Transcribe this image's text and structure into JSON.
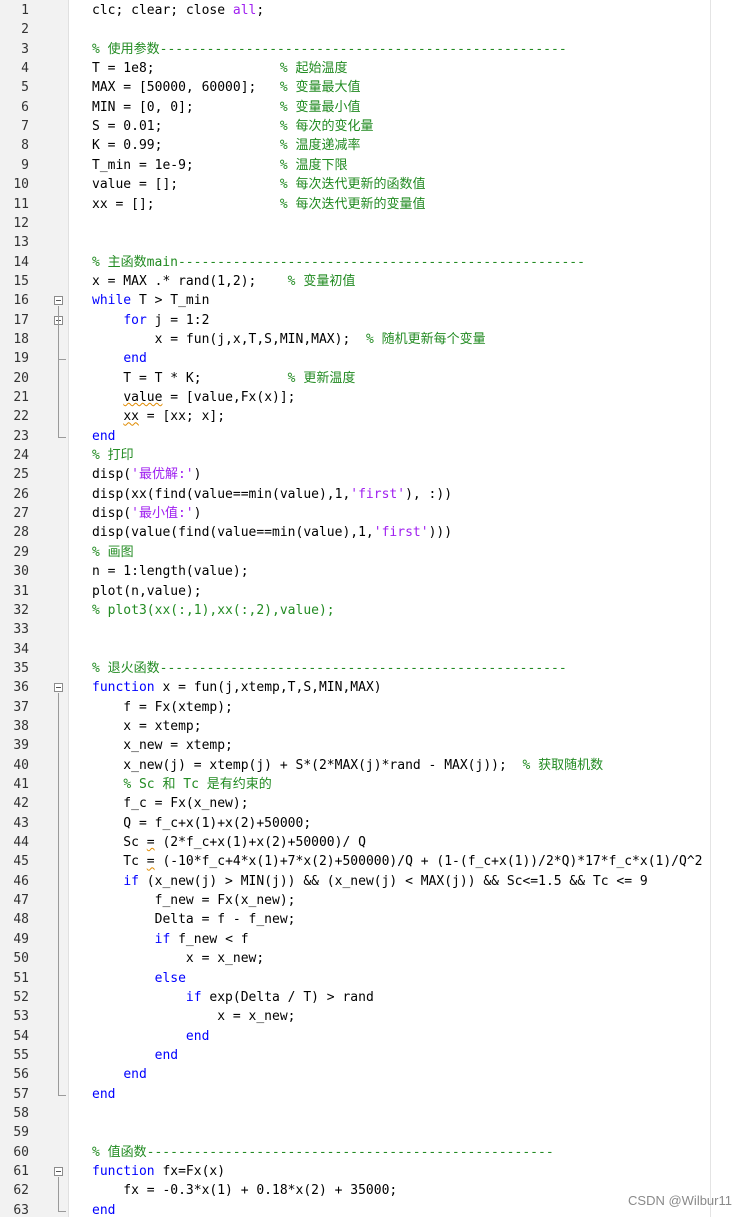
{
  "editor": {
    "lines": [
      {
        "n": "1",
        "t": "clc; clear; close all;",
        "spans": [
          {
            "s": "clc; clear; close ",
            "c": ""
          },
          {
            "s": "all",
            "c": "str"
          },
          {
            "s": ";",
            "c": ""
          }
        ]
      },
      {
        "n": "2",
        "spans": []
      },
      {
        "n": "3",
        "spans": [
          {
            "s": "% 使用参数----------------------------------------------------",
            "c": "cm"
          }
        ]
      },
      {
        "n": "4",
        "spans": [
          {
            "s": "T = 1e8;                ",
            "c": ""
          },
          {
            "s": "% 起始温度",
            "c": "cm"
          }
        ]
      },
      {
        "n": "5",
        "spans": [
          {
            "s": "MAX = [50000, 60000];   ",
            "c": ""
          },
          {
            "s": "% 变量最大值",
            "c": "cm"
          }
        ]
      },
      {
        "n": "6",
        "spans": [
          {
            "s": "MIN = [0, 0];           ",
            "c": ""
          },
          {
            "s": "% 变量最小值",
            "c": "cm"
          }
        ]
      },
      {
        "n": "7",
        "spans": [
          {
            "s": "S = 0.01;               ",
            "c": ""
          },
          {
            "s": "% 每次的变化量",
            "c": "cm"
          }
        ]
      },
      {
        "n": "8",
        "spans": [
          {
            "s": "K = 0.99;               ",
            "c": ""
          },
          {
            "s": "% 温度递减率",
            "c": "cm"
          }
        ]
      },
      {
        "n": "9",
        "spans": [
          {
            "s": "T_min = 1e-9;           ",
            "c": ""
          },
          {
            "s": "% 温度下限",
            "c": "cm"
          }
        ]
      },
      {
        "n": "10",
        "spans": [
          {
            "s": "value = [];             ",
            "c": ""
          },
          {
            "s": "% 每次迭代更新的函数值",
            "c": "cm"
          }
        ]
      },
      {
        "n": "11",
        "spans": [
          {
            "s": "xx = [];                ",
            "c": ""
          },
          {
            "s": "% 每次迭代更新的变量值",
            "c": "cm"
          }
        ]
      },
      {
        "n": "12",
        "spans": []
      },
      {
        "n": "13",
        "spans": []
      },
      {
        "n": "14",
        "spans": [
          {
            "s": "% 主函数main----------------------------------------------------",
            "c": "cm"
          }
        ]
      },
      {
        "n": "15",
        "spans": [
          {
            "s": "x = MAX .* rand(1,2);    ",
            "c": ""
          },
          {
            "s": "% 变量初值",
            "c": "cm"
          }
        ]
      },
      {
        "n": "16",
        "spans": [
          {
            "s": "while",
            "c": "kw"
          },
          {
            "s": " T > T_min",
            "c": ""
          }
        ]
      },
      {
        "n": "17",
        "spans": [
          {
            "s": "    ",
            "c": ""
          },
          {
            "s": "for",
            "c": "kw"
          },
          {
            "s": " j = 1:2",
            "c": ""
          }
        ]
      },
      {
        "n": "18",
        "spans": [
          {
            "s": "        x = fun(j,x,T,S,MIN,MAX);  ",
            "c": ""
          },
          {
            "s": "% 随机更新每个变量",
            "c": "cm"
          }
        ]
      },
      {
        "n": "19",
        "spans": [
          {
            "s": "    ",
            "c": ""
          },
          {
            "s": "end",
            "c": "kw"
          }
        ]
      },
      {
        "n": "20",
        "spans": [
          {
            "s": "    T = T * K;           ",
            "c": ""
          },
          {
            "s": "% 更新温度",
            "c": "cm"
          }
        ]
      },
      {
        "n": "21",
        "spans": [
          {
            "s": "    ",
            "c": ""
          },
          {
            "s": "value",
            "c": "sq"
          },
          {
            "s": " = [value,Fx(x)];",
            "c": ""
          }
        ]
      },
      {
        "n": "22",
        "spans": [
          {
            "s": "    ",
            "c": ""
          },
          {
            "s": "xx",
            "c": "sq"
          },
          {
            "s": " = [xx; x];",
            "c": ""
          }
        ]
      },
      {
        "n": "23",
        "spans": [
          {
            "s": "end",
            "c": "kw"
          }
        ]
      },
      {
        "n": "24",
        "spans": [
          {
            "s": "% 打印",
            "c": "cm"
          }
        ]
      },
      {
        "n": "25",
        "spans": [
          {
            "s": "disp(",
            "c": ""
          },
          {
            "s": "'最优解:'",
            "c": "str"
          },
          {
            "s": ")",
            "c": ""
          }
        ]
      },
      {
        "n": "26",
        "spans": [
          {
            "s": "disp(xx(find(value==min(value),1,",
            "c": ""
          },
          {
            "s": "'first'",
            "c": "str"
          },
          {
            "s": "), :))",
            "c": ""
          }
        ]
      },
      {
        "n": "27",
        "spans": [
          {
            "s": "disp(",
            "c": ""
          },
          {
            "s": "'最小值:'",
            "c": "str"
          },
          {
            "s": ")",
            "c": ""
          }
        ]
      },
      {
        "n": "28",
        "spans": [
          {
            "s": "disp(value(find(value==min(value),1,",
            "c": ""
          },
          {
            "s": "'first'",
            "c": "str"
          },
          {
            "s": ")))",
            "c": ""
          }
        ]
      },
      {
        "n": "29",
        "spans": [
          {
            "s": "% 画图",
            "c": "cm"
          }
        ]
      },
      {
        "n": "30",
        "spans": [
          {
            "s": "n = 1:length(value);",
            "c": ""
          }
        ]
      },
      {
        "n": "31",
        "spans": [
          {
            "s": "plot(n,value);",
            "c": ""
          }
        ]
      },
      {
        "n": "32",
        "spans": [
          {
            "s": "% plot3(xx(:,1),xx(:,2),value);",
            "c": "cm"
          }
        ]
      },
      {
        "n": "33",
        "spans": []
      },
      {
        "n": "34",
        "spans": []
      },
      {
        "n": "35",
        "spans": [
          {
            "s": "% 退火函数----------------------------------------------------",
            "c": "cm"
          }
        ]
      },
      {
        "n": "36",
        "spans": [
          {
            "s": "function",
            "c": "kw"
          },
          {
            "s": " x = fun(j,xtemp,T,S,MIN,MAX)",
            "c": ""
          }
        ]
      },
      {
        "n": "37",
        "spans": [
          {
            "s": "    f = Fx(xtemp);",
            "c": ""
          }
        ]
      },
      {
        "n": "38",
        "spans": [
          {
            "s": "    x = xtemp;",
            "c": ""
          }
        ]
      },
      {
        "n": "39",
        "spans": [
          {
            "s": "    x_new = xtemp;",
            "c": ""
          }
        ]
      },
      {
        "n": "40",
        "spans": [
          {
            "s": "    x_new(j) = xtemp(j) + S*(2*MAX(j)*rand - MAX(j));  ",
            "c": ""
          },
          {
            "s": "% 获取随机数",
            "c": "cm"
          }
        ]
      },
      {
        "n": "41",
        "spans": [
          {
            "s": "    ",
            "c": ""
          },
          {
            "s": "% Sc 和 Tc 是有约束的",
            "c": "cm"
          }
        ]
      },
      {
        "n": "42",
        "spans": [
          {
            "s": "    f_c = Fx(x_new);",
            "c": ""
          }
        ]
      },
      {
        "n": "43",
        "spans": [
          {
            "s": "    Q = f_c+x(1)+x(2)+50000;",
            "c": ""
          }
        ]
      },
      {
        "n": "44",
        "spans": [
          {
            "s": "    Sc ",
            "c": ""
          },
          {
            "s": "=",
            "c": "sq"
          },
          {
            "s": " (2*f_c+x(1)+x(2)+50000)/ Q",
            "c": ""
          }
        ]
      },
      {
        "n": "45",
        "spans": [
          {
            "s": "    Tc ",
            "c": ""
          },
          {
            "s": "=",
            "c": "sq"
          },
          {
            "s": " (-10*f_c+4*x(1)+7*x(2)+500000)/Q + (1-(f_c+x(1))/2*Q)*17*f_c*x(1)/Q^2",
            "c": ""
          }
        ]
      },
      {
        "n": "46",
        "spans": [
          {
            "s": "    ",
            "c": ""
          },
          {
            "s": "if",
            "c": "kw"
          },
          {
            "s": " (x_new(j) > MIN(j)) && (x_new(j) < MAX(j)) && Sc<=1.5 && Tc <= 9",
            "c": ""
          }
        ]
      },
      {
        "n": "47",
        "spans": [
          {
            "s": "        f_new = Fx(x_new);",
            "c": ""
          }
        ]
      },
      {
        "n": "48",
        "spans": [
          {
            "s": "        Delta = f - f_new;",
            "c": ""
          }
        ]
      },
      {
        "n": "49",
        "spans": [
          {
            "s": "        ",
            "c": ""
          },
          {
            "s": "if",
            "c": "kw"
          },
          {
            "s": " f_new < f",
            "c": ""
          }
        ]
      },
      {
        "n": "50",
        "spans": [
          {
            "s": "            x = x_new;",
            "c": ""
          }
        ]
      },
      {
        "n": "51",
        "spans": [
          {
            "s": "        ",
            "c": ""
          },
          {
            "s": "else",
            "c": "kw"
          }
        ]
      },
      {
        "n": "52",
        "spans": [
          {
            "s": "            ",
            "c": ""
          },
          {
            "s": "if",
            "c": "kw"
          },
          {
            "s": " exp(Delta / T) > rand",
            "c": ""
          }
        ]
      },
      {
        "n": "53",
        "spans": [
          {
            "s": "                x = x_new;",
            "c": ""
          }
        ]
      },
      {
        "n": "54",
        "spans": [
          {
            "s": "            ",
            "c": ""
          },
          {
            "s": "end",
            "c": "kw"
          }
        ]
      },
      {
        "n": "55",
        "spans": [
          {
            "s": "        ",
            "c": ""
          },
          {
            "s": "end",
            "c": "kw"
          }
        ]
      },
      {
        "n": "56",
        "spans": [
          {
            "s": "    ",
            "c": ""
          },
          {
            "s": "end",
            "c": "kw"
          }
        ]
      },
      {
        "n": "57",
        "spans": [
          {
            "s": "end",
            "c": "kw"
          }
        ]
      },
      {
        "n": "58",
        "spans": []
      },
      {
        "n": "59",
        "spans": []
      },
      {
        "n": "60",
        "spans": [
          {
            "s": "% 值函数----------------------------------------------------",
            "c": "cm"
          }
        ]
      },
      {
        "n": "61",
        "spans": [
          {
            "s": "function",
            "c": "kw"
          },
          {
            "s": " fx=Fx(x)",
            "c": ""
          }
        ]
      },
      {
        "n": "62",
        "spans": [
          {
            "s": "    fx = -0.3*x(1) + 0.18*x(2) + 35000;",
            "c": ""
          }
        ]
      },
      {
        "n": "63",
        "spans": [
          {
            "s": "end",
            "c": "kw"
          }
        ]
      }
    ],
    "fold_markers": [
      "16",
      "17",
      "36",
      "61"
    ]
  },
  "watermark": "CSDN @Wilbur11",
  "colors": {
    "keyword": "#0000ff",
    "comment": "#228b22",
    "string": "#a020f0",
    "text": "#000000"
  }
}
